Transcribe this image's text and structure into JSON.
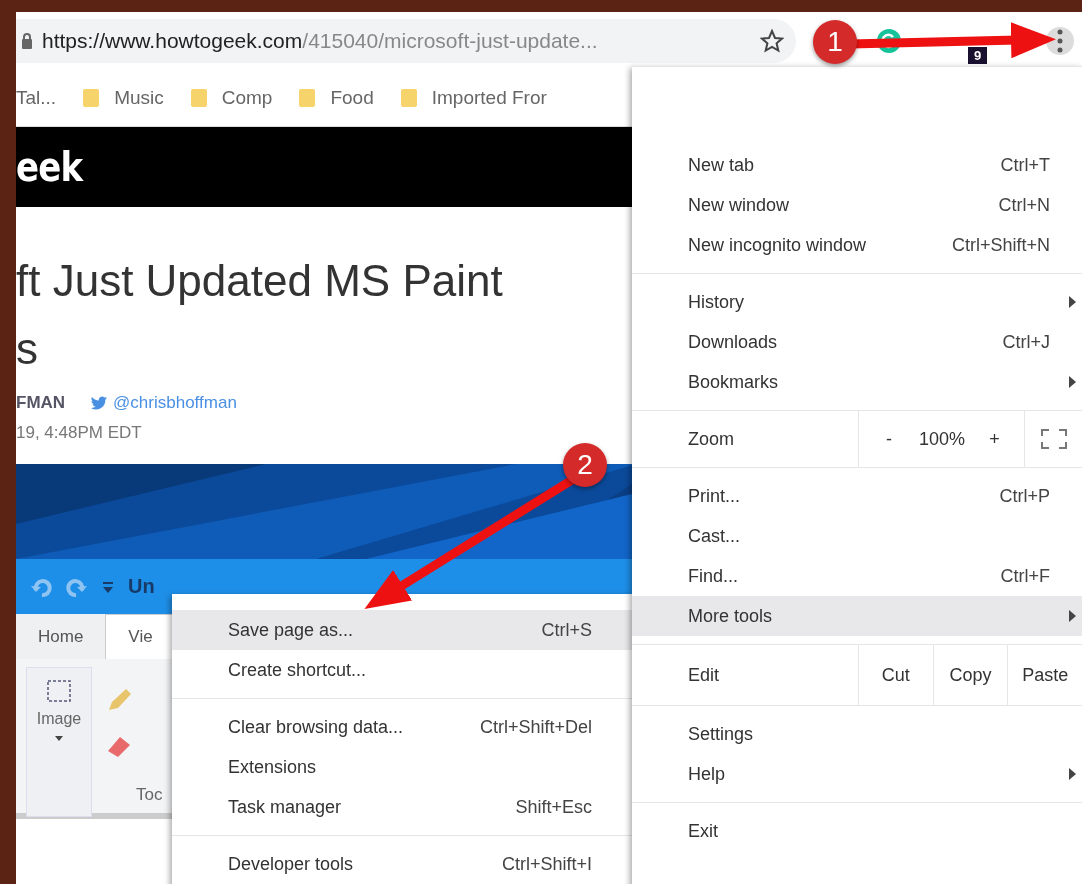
{
  "address_bar": {
    "url_host": "https://www.howtogeek.com",
    "url_path": "/415040/microsoft-just-update..."
  },
  "extension_badge": "9",
  "bookmarks": [
    {
      "label": "Tal...",
      "kind": "page"
    },
    {
      "label": "Music",
      "kind": "folder"
    },
    {
      "label": "Comp",
      "kind": "folder"
    },
    {
      "label": "Food",
      "kind": "folder"
    },
    {
      "label": "Imported Fror",
      "kind": "folder"
    }
  ],
  "site": {
    "logo": "eek",
    "title_lines": [
      "ft Just Updated MS Paint",
      "s"
    ],
    "author": "FMAN",
    "twitter": "@chrisbhoffman",
    "date": "19, 4:48PM EDT"
  },
  "paint": {
    "title": "Un",
    "tabs": [
      {
        "label": "Home",
        "selected": true
      },
      {
        "label": "Vie",
        "selected": false
      }
    ],
    "image_button": "Image",
    "group_label": "Toc"
  },
  "menu": {
    "sections": [
      {
        "items": [
          {
            "kind": "item",
            "label": "New tab",
            "shortcut": "Ctrl+T",
            "submenu": false,
            "selected": false
          },
          {
            "kind": "item",
            "label": "New window",
            "shortcut": "Ctrl+N",
            "submenu": false,
            "selected": false
          },
          {
            "kind": "item",
            "label": "New incognito window",
            "shortcut": "Ctrl+Shift+N",
            "submenu": false,
            "selected": false
          }
        ]
      },
      {
        "items": [
          {
            "kind": "item",
            "label": "History",
            "submenu": true,
            "selected": false
          },
          {
            "kind": "item",
            "label": "Downloads",
            "shortcut": "Ctrl+J",
            "submenu": false,
            "selected": false
          },
          {
            "kind": "item",
            "label": "Bookmarks",
            "submenu": true,
            "selected": false
          }
        ]
      },
      {
        "items": [
          {
            "kind": "zoom",
            "label": "Zoom",
            "minus": "-",
            "value": "100%",
            "plus": "+"
          }
        ]
      },
      {
        "items": [
          {
            "kind": "item",
            "label": "Print...",
            "shortcut": "Ctrl+P",
            "submenu": false,
            "selected": false
          },
          {
            "kind": "item",
            "label": "Cast...",
            "submenu": false,
            "selected": false
          },
          {
            "kind": "item",
            "label": "Find...",
            "shortcut": "Ctrl+F",
            "submenu": false,
            "selected": false
          },
          {
            "kind": "item",
            "label": "More tools",
            "submenu": true,
            "selected": true
          }
        ]
      },
      {
        "items": [
          {
            "kind": "edit",
            "label": "Edit",
            "actions": [
              "Cut",
              "Copy",
              "Paste"
            ]
          }
        ]
      },
      {
        "items": [
          {
            "kind": "item",
            "label": "Settings",
            "submenu": false,
            "selected": false
          },
          {
            "kind": "item",
            "label": "Help",
            "submenu": true,
            "selected": false
          }
        ]
      },
      {
        "items": [
          {
            "kind": "item",
            "label": "Exit",
            "submenu": false,
            "selected": false
          }
        ]
      }
    ]
  },
  "submenu": {
    "sections": [
      {
        "items": [
          {
            "label": "Save page as...",
            "shortcut": "Ctrl+S",
            "selected": true
          },
          {
            "label": "Create shortcut...",
            "selected": false
          }
        ]
      },
      {
        "items": [
          {
            "label": "Clear browsing data...",
            "shortcut": "Ctrl+Shift+Del",
            "selected": false
          },
          {
            "label": "Extensions",
            "selected": false
          },
          {
            "label": "Task manager",
            "shortcut": "Shift+Esc",
            "selected": false
          }
        ]
      },
      {
        "items": [
          {
            "label": "Developer tools",
            "shortcut": "Ctrl+Shift+I",
            "selected": false
          }
        ]
      }
    ]
  },
  "annotations": [
    {
      "number": "1"
    },
    {
      "number": "2"
    }
  ]
}
